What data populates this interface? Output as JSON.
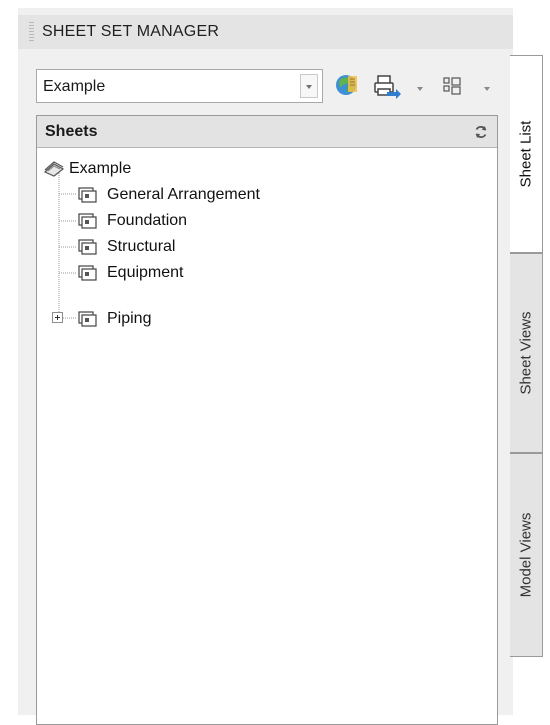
{
  "panel": {
    "title": "SHEET SET MANAGER"
  },
  "toolbar": {
    "sheet_set_select": {
      "value": "Example"
    },
    "icons": [
      "sheet-set-icon",
      "publish-icon",
      "view-options-icon"
    ]
  },
  "sheets": {
    "header": "Sheets",
    "root": {
      "label": "Example",
      "icon": "sheet-set-icon"
    },
    "items": [
      {
        "label": "General Arrangement",
        "icon": "sheet-icon",
        "expandable": false
      },
      {
        "label": "Foundation",
        "icon": "sheet-icon",
        "expandable": false
      },
      {
        "label": "Structural",
        "icon": "sheet-icon",
        "expandable": false
      },
      {
        "label": "Equipment",
        "icon": "sheet-icon",
        "expandable": false
      },
      {
        "label": "Piping",
        "icon": "sheet-icon",
        "expandable": true
      }
    ]
  },
  "tabs": [
    {
      "label": "Sheet List",
      "active": true
    },
    {
      "label": "Sheet Views",
      "active": false
    },
    {
      "label": "Model Views",
      "active": false
    }
  ],
  "colors": {
    "panel_bg": "#f0f0f0",
    "title_bar_bg": "#e4e4e4",
    "header_bg": "#e3e3e3",
    "border": "#9a9a9a"
  }
}
